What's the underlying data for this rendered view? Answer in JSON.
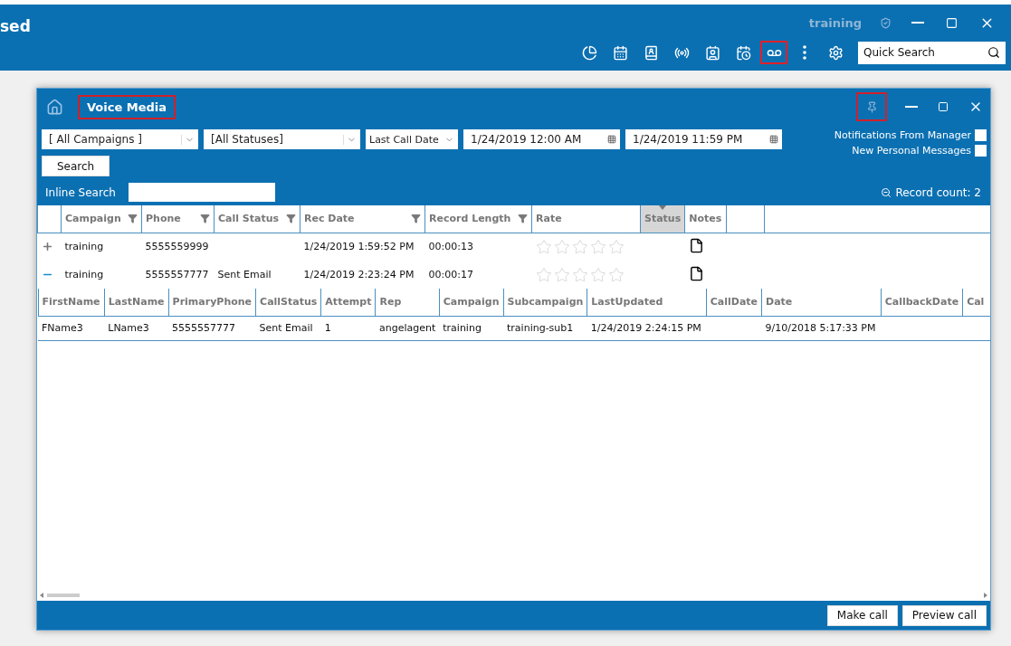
{
  "app_header": {
    "title": "sed",
    "user": "training",
    "toolbar": [
      {
        "kind": "pie",
        "highlighted": false
      },
      {
        "kind": "calendar",
        "highlighted": false
      },
      {
        "kind": "phonebook",
        "highlighted": false
      },
      {
        "kind": "broadcast",
        "highlighted": false
      },
      {
        "kind": "contacts",
        "highlighted": false
      },
      {
        "kind": "billing",
        "highlighted": false
      },
      {
        "kind": "voicemail",
        "highlighted": true
      },
      {
        "kind": "more",
        "highlighted": false
      },
      {
        "kind": "settings",
        "highlighted": false
      }
    ],
    "quick_search": {
      "placeholder": "Quick Search"
    }
  },
  "dialog": {
    "title": "Voice Media",
    "title_highlighted": true,
    "pin_highlighted": true,
    "filters": {
      "campaign": "[ All Campaigns ]",
      "status": "[All Statuses]",
      "date_type": "Last Call Date",
      "from": "1/24/2019 12:00 AM",
      "to": "1/24/2019 11:59 PM",
      "search_button": "Search"
    },
    "options": [
      {
        "label": "Notifications From Manager",
        "checked": false
      },
      {
        "label": "New Personal Messages",
        "checked": false
      }
    ],
    "inline_search": {
      "label": "Inline Search"
    },
    "record_count": "Record count: 2",
    "grid": {
      "columns": [
        {
          "label": "Campaign",
          "filter": true,
          "sorted": false
        },
        {
          "label": "Phone",
          "filter": true,
          "sorted": false
        },
        {
          "label": "Call Status",
          "filter": true,
          "sorted": false
        },
        {
          "label": "Rec Date",
          "filter": true,
          "sorted": false
        },
        {
          "label": "Record Length",
          "filter": true,
          "sorted": false
        },
        {
          "label": "Rate",
          "filter": false,
          "sorted": false
        },
        {
          "label": "Status",
          "filter": false,
          "sorted": true
        },
        {
          "label": "Notes",
          "filter": false,
          "sorted": false
        }
      ],
      "rows": [
        {
          "expanded": false,
          "campaign": "training",
          "phone": "5555559999",
          "call_status": "",
          "rec_date": "1/24/2019 1:59:52 PM",
          "record_length": "00:00:13",
          "stars": 0
        },
        {
          "expanded": true,
          "campaign": "training",
          "phone": "5555557777",
          "call_status": "Sent Email",
          "rec_date": "1/24/2019 2:23:24 PM",
          "record_length": "00:00:17",
          "stars": 0
        }
      ],
      "detail": {
        "columns": [
          "FirstName",
          "LastName",
          "PrimaryPhone",
          "CallStatus",
          "Attempt",
          "Rep",
          "Campaign",
          "Subcampaign",
          "LastUpdated",
          "CallDate",
          "Date",
          "CallbackDate",
          "Cal"
        ],
        "rows": [
          [
            "FName3",
            "LName3",
            "5555557777",
            "Sent Email",
            "1",
            "angelagent",
            "training",
            "training-sub1",
            "1/24/2019 2:24:15 PM",
            "",
            "9/10/2018 5:17:33 PM",
            "",
            ""
          ]
        ]
      }
    },
    "buttons": [
      "Make call",
      "Preview call"
    ]
  }
}
